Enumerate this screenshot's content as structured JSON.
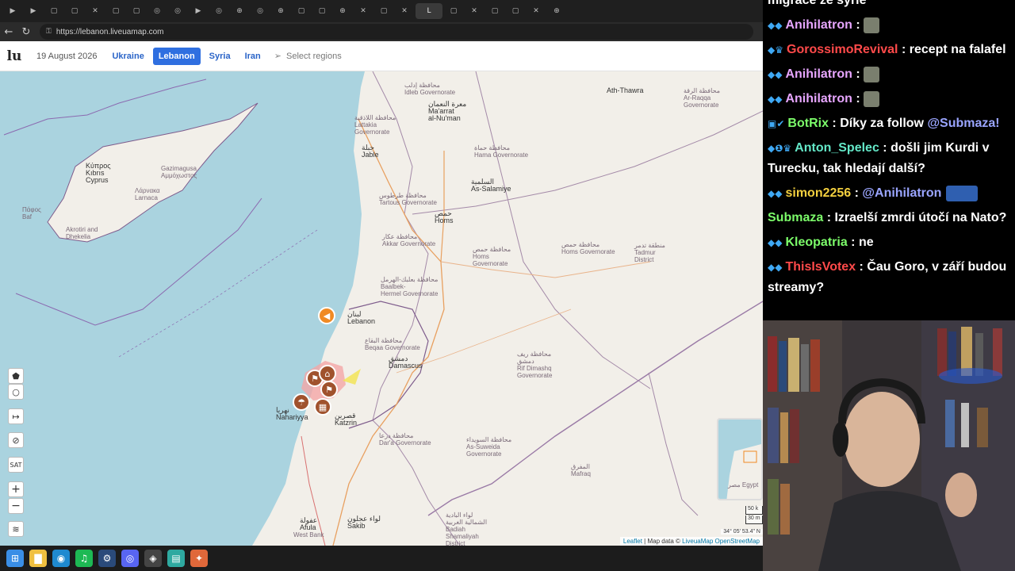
{
  "browser": {
    "url": "https://lebanon.liveuamap.com",
    "active_tab_label": "L",
    "tabs": [
      "▶",
      "▶",
      "▢",
      "▢",
      "✕",
      "▢",
      "▢",
      "◎",
      "◎",
      "▶",
      "◎",
      "⊕",
      "◎",
      "⊕",
      "▢",
      "▢",
      "⊕",
      "✕",
      "▢",
      "✕",
      "▢",
      "✕",
      "▢",
      "▢",
      "✕",
      "⊕"
    ]
  },
  "lum": {
    "logo": "lu",
    "date": "19 August 2026",
    "regions": [
      "Ukraine",
      "Lebanon",
      "Syria",
      "Iran"
    ],
    "active_region": "Lebanon",
    "select_regions": "Select regions"
  },
  "map": {
    "labels": [
      {
        "text": "Κύπρος\nKıbrıs\nCyprus",
        "cls": "city"
      },
      {
        "text": "Gazimagusa\nΑμμόχωστος"
      },
      {
        "text": "Λάρνακα\nLarnaca"
      },
      {
        "text": "Πάφος\nBaf"
      },
      {
        "text": "Akrotiri and\nDhekelia"
      },
      {
        "text": "محافظة إدلب\nIdleb Governorate"
      },
      {
        "text": "معرة النعمان\nMa'arrat\nal-Nu'man",
        "cls": "city"
      },
      {
        "text": "محافظة اللاذقية\nLattakia\nGovernorate"
      },
      {
        "text": "جبلة\nJable",
        "cls": "city"
      },
      {
        "text": "محافظة حماة\nHama Governorate"
      },
      {
        "text": "السلمية\nAs-Salamiye",
        "cls": "city"
      },
      {
        "text": "محافظة طرطوس\nTartous Governorate"
      },
      {
        "text": "حمص\nHoms",
        "cls": "city"
      },
      {
        "text": "محافظة عكار\nAkkar Governorate"
      },
      {
        "text": "محافظة حمص\nHoms\nGovernorate"
      },
      {
        "text": "محافظة حمص\nHoms Governorate"
      },
      {
        "text": "منطقة تدمر\nTadmur\nDistrict"
      },
      {
        "text": "محافظة بعلبك-الهرمل\nBaalbek-\nHermel Governorate"
      },
      {
        "text": "لبنان\nLebanon",
        "cls": "city"
      },
      {
        "text": "محافظة البقاع\nBeqaa Governorate"
      },
      {
        "text": "دمشق\nDamascus",
        "cls": "city"
      },
      {
        "text": "محافظة ريف\nدمشق\nRif Dimashq\nGovernorate"
      },
      {
        "text": "نهريا\nNahariyya",
        "cls": "city"
      },
      {
        "text": "قصرين\nKatzrin",
        "cls": "city"
      },
      {
        "text": "محافظة درعا\nDar'a Governorate"
      },
      {
        "text": "محافظة السويداء\nAs-Suweida\nGovernorate"
      },
      {
        "text": "المفرق\nMafraq"
      },
      {
        "text": "عفولة\nAfula",
        "cls": "city"
      },
      {
        "text": "West Bank"
      },
      {
        "text": "لواء عجلون\nSakib",
        "cls": "city"
      },
      {
        "text": "لواء البادية\nالشمالية الغربية\nBadiah\nShamaliyah\nDistrict"
      },
      {
        "text": "Ath-Thawra",
        "cls": "city"
      },
      {
        "text": "محافظة الرقة\nAr-Raqqa\nGovernorate"
      },
      {
        "text": "مصر\nEgypt"
      }
    ],
    "controls": [
      "⬟",
      "○",
      "↦",
      "⊘",
      "SAT",
      "+",
      "−",
      "≋"
    ],
    "coords": "34° 05' 53.4\" N",
    "scale": [
      "50 k",
      "30 m"
    ],
    "attribution": {
      "leaflet": "Leaflet",
      "text": " | Map data © ",
      "lum": "LiveuaMap",
      "osm": " OpenStreetMap"
    }
  },
  "taskbar": [
    "⊞",
    "▇",
    "◉",
    "♫",
    "⚙",
    "◎",
    "◈",
    "▤",
    "✦"
  ],
  "chat": [
    {
      "badges": "",
      "user": "",
      "color": "#ffffff",
      "text": "migrace ze sýrie",
      "partial": true
    },
    {
      "badges": "◆◆",
      "user": "Anihilatron",
      "color": "#e7a6ff",
      "text": "",
      "emote": true
    },
    {
      "badges": "◆♛",
      "user": "GorossimoRevival",
      "color": "#ff4a4a",
      "text": "recept na falafel"
    },
    {
      "badges": "◆◆",
      "user": "Anihilatron",
      "color": "#e7a6ff",
      "text": "",
      "emote": true
    },
    {
      "badges": "◆◆",
      "user": "Anihilatron",
      "color": "#e7a6ff",
      "text": "",
      "emote": true
    },
    {
      "badges": "▣✔",
      "user": "BotRix",
      "color": "#7cfc6a",
      "text": "Díky za follow ",
      "mention": "@Submaza!"
    },
    {
      "badges": "◆❶♛",
      "user": "Anton_Spelec",
      "color": "#64e8c8",
      "text": "došli jim Kurdi v Turecku, tak hledají další?"
    },
    {
      "badges": "◆◆",
      "user": "simon2256",
      "color": "#f4d03f",
      "text": "",
      "mention": "@Anihilatron",
      "emote_wide": true
    },
    {
      "badges": "",
      "user": "Submaza",
      "color": "#7cfc6a",
      "text": "Izraelší zmrdi útočí na Nato?"
    },
    {
      "badges": "◆◆",
      "user": "Kleopatria",
      "color": "#7cfc6a",
      "text": "ne"
    },
    {
      "badges": "◆◆",
      "user": "ThisIsVotex",
      "color": "#ff4a4a",
      "text": "Čau Goro, v září budou streamy?"
    }
  ],
  "colors": {
    "sea": "#aad3df",
    "land": "#f2efe9",
    "accent": "#2f6fe0",
    "marker_brown": "#a0522d",
    "marker_orange": "#f08a24",
    "hotzone": "#f4a6a6"
  }
}
